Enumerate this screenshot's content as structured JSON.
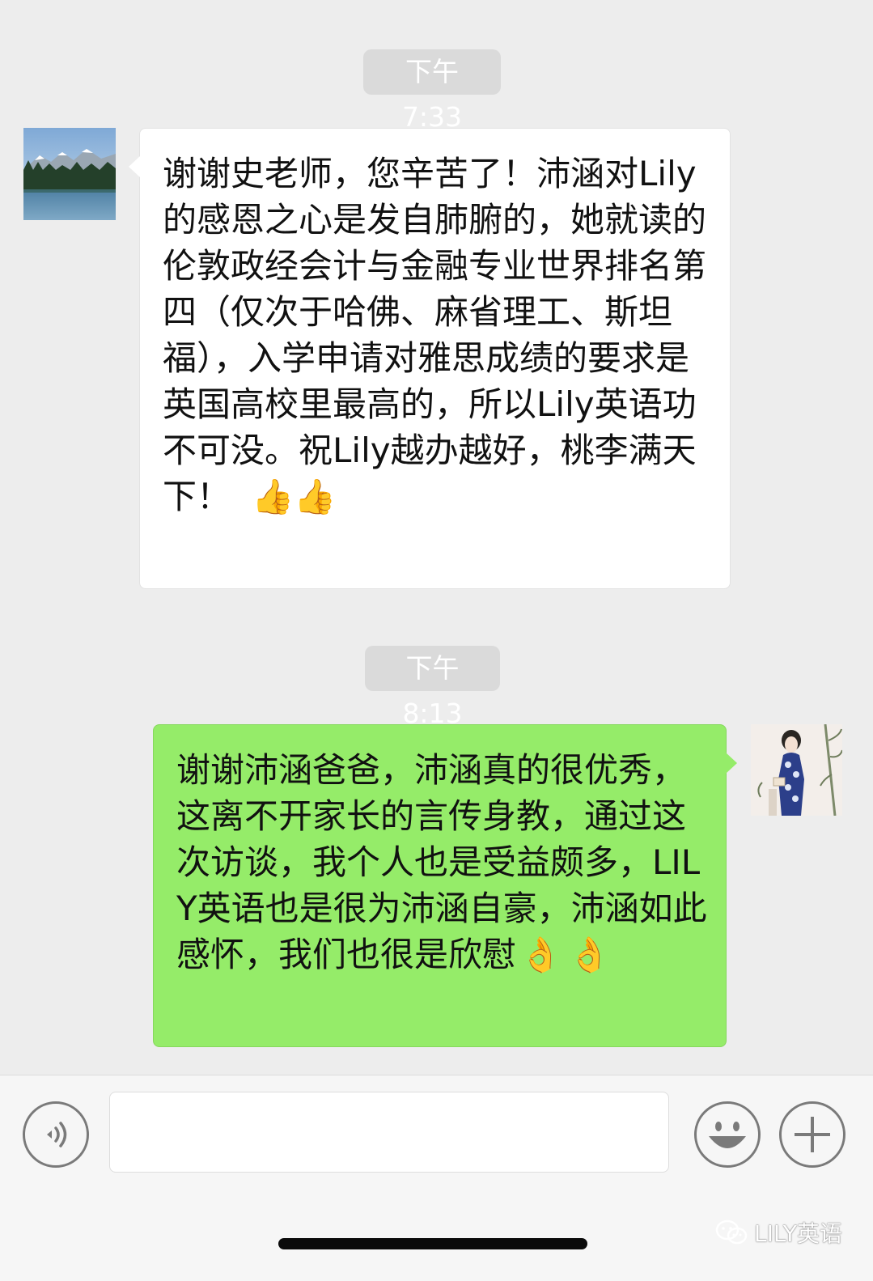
{
  "chat": {
    "timestamps": [
      "下午7:33",
      "下午8:13"
    ],
    "messages": [
      {
        "side": "left",
        "avatar": "mountain-lake-avatar",
        "text": "谢谢史老师，您辛苦了！沛涵对Lily的感恩之心是发自肺腑的，她就读的伦敦政经会计与金融专业世界排名第四（仅次于哈佛、麻省理工、斯坦福），入学申请对雅思成绩的要求是英国高校里最高的，所以Lily英语功不可没。祝Lily越办越好，桃李满天下！",
        "emojis": [
          "👍",
          "👍"
        ],
        "bubble_color": "#ffffff"
      },
      {
        "side": "right",
        "avatar": "qipao-woman-avatar",
        "text": "谢谢沛涵爸爸，沛涵真的很优秀，这离不开家长的言传身教，通过这次访谈，我个人也是受益颇多，LILY英语也是很为沛涵自豪，沛涵如此感怀，我们也很是欣慰",
        "emojis": [
          "👌",
          "👌"
        ],
        "bubble_color": "#95ec69"
      }
    ]
  },
  "input_bar": {
    "voice_icon": "voice-icon",
    "input_value": "",
    "emoji_icon": "smiley-icon",
    "plus_icon": "plus-icon"
  },
  "watermark": {
    "text": "LILY英语",
    "icon": "wechat-icon"
  }
}
